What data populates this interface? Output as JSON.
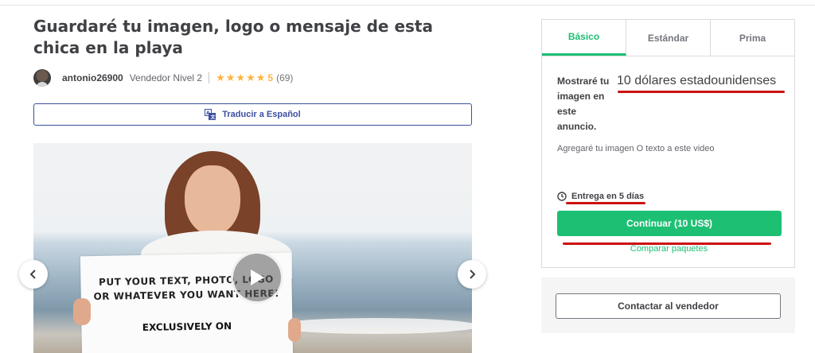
{
  "gig": {
    "title": "Guardaré tu imagen, logo o mensaje de esta chica en la playa",
    "seller_name": "antonio26900",
    "seller_level": "Vendedor Nivel 2",
    "rating": "5",
    "review_count": "(69)",
    "translate_label": "Traducir a Español"
  },
  "media": {
    "sign_line1": "PUT YOUR TEXT, PHOTO, LOGO",
    "sign_line2": "OR WHATEVER YOU WANT HERE!",
    "sign_line3": "EXCLUSIVELY ON"
  },
  "package": {
    "tabs": [
      {
        "label": "Básico"
      },
      {
        "label": "Estándar"
      },
      {
        "label": "Prima"
      }
    ],
    "name": "Mostraré tu imagen en este anuncio.",
    "price": "10 dólares estadounidenses",
    "description": "Agregaré tu imagen O texto a este video",
    "delivery": "Entrega en 5 días",
    "continue_label": "Continuar (10 US$)",
    "compare_label": "Comparar paquetes"
  },
  "contact": {
    "label": "Contactar al vendedor"
  },
  "colors": {
    "accent_green": "#1dbf73",
    "link_blue": "#3d4f9f",
    "star_yellow": "#ffb33e",
    "annotation_red": "#cc1111"
  },
  "icons": [
    "translate-icon",
    "star-icon",
    "play-icon",
    "chevron-left-icon",
    "chevron-right-icon",
    "clock-icon"
  ]
}
